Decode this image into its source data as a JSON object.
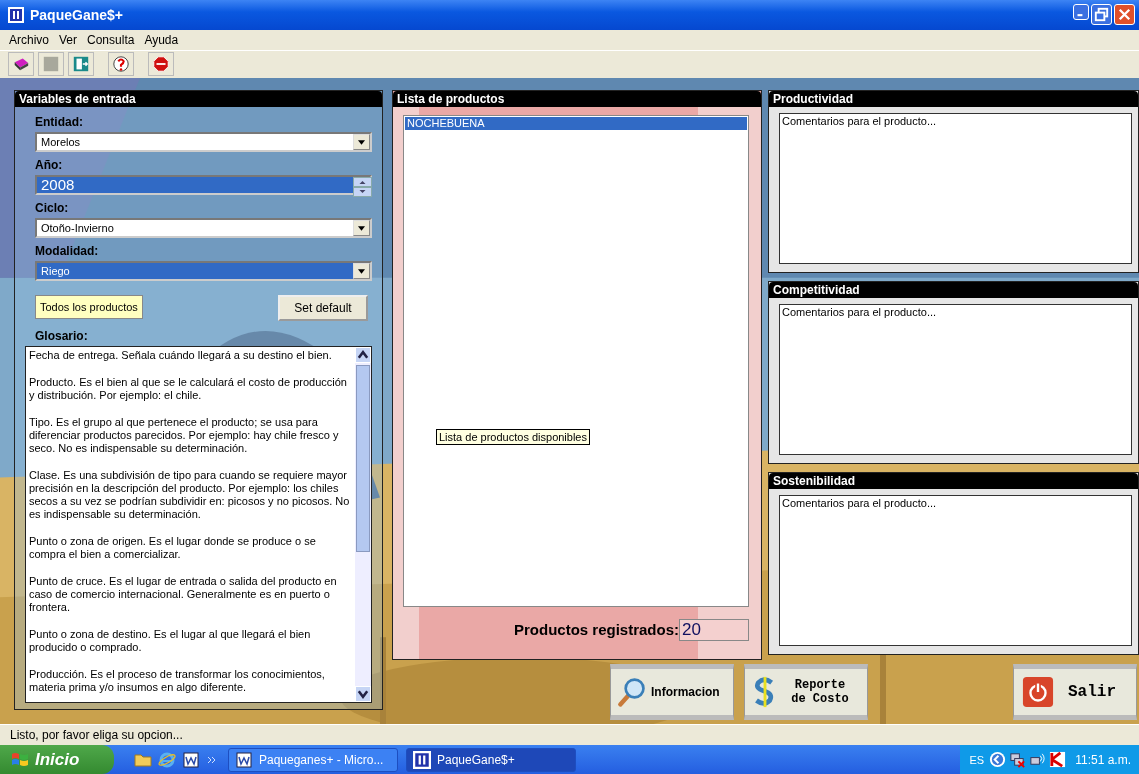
{
  "window": {
    "title": "PaqueGane$+"
  },
  "menu": [
    "Archivo",
    "Ver",
    "Consulta",
    "Ayuda"
  ],
  "inputs": {
    "title": "Variables de entrada",
    "fields": [
      {
        "label": "Entidad:",
        "kind": "combo",
        "value": "Morelos",
        "highlighted": false
      },
      {
        "label": "Año:",
        "kind": "spinner",
        "value": "2008",
        "highlighted": true
      },
      {
        "label": "Ciclo:",
        "kind": "combo",
        "value": "Otoño-Invierno",
        "highlighted": false
      },
      {
        "label": "Modalidad:",
        "kind": "combo",
        "value": "Riego",
        "highlighted": true
      }
    ],
    "all_products_button": "Todos los productos",
    "default_button": "Set default",
    "glossary_label": "Glosario:",
    "glossary": [
      "Fecha de entrega. Señala cuándo llegará a su destino el bien.",
      "Producto. Es el bien al que se le calculará el costo de producción y distribución. Por ejemplo: el chile.",
      "Tipo. Es el grupo al que pertenece el producto; se usa para diferenciar productos parecidos. Por ejemplo: hay chile fresco y seco. No es indispensable su determinación.",
      "Clase. Es una subdivisión de tipo para cuando se requiere mayor precisión en la descripción del producto. Por ejemplo: los chiles secos a su vez se podrían subdividir en: picosos y no picosos. No es indispensable su determinación.",
      "Punto o zona de origen. Es el lugar donde se produce o se compra el bien a comercializar.",
      "Punto de cruce. Es el lugar de entrada o salida del producto en caso de comercio internacional. Generalmente es en puerto o frontera.",
      "Punto o zona de destino. Es el lugar al que llegará el bien producido o comprado.",
      "Producción. Es el proceso de transformar los conocimientos, materia prima y/o insumos en algo diferente."
    ]
  },
  "products": {
    "title": "Lista de productos",
    "items": [
      {
        "label": "NOCHEBUENA",
        "selected": true
      }
    ],
    "tooltip": "Lista de productos disponibles",
    "count_label": "Productos registrados:",
    "count": "20"
  },
  "comments": [
    {
      "title": "Productividad",
      "text": "Comentarios para el producto..."
    },
    {
      "title": "Competitividad",
      "text": "Comentarios para el producto..."
    },
    {
      "title": "Sostenibilidad",
      "text": "Comentarios para el producto..."
    }
  ],
  "actions": [
    {
      "kind": "info",
      "label": "Informacion"
    },
    {
      "kind": "report",
      "label": "Reporte de Costo"
    },
    {
      "kind": "exit",
      "label": "Salir"
    }
  ],
  "status_bar": "Listo, por favor eliga su opcion...",
  "taskbar": {
    "start": "Inicio",
    "tasks": [
      {
        "label": "Paqueganes+ - Micro...",
        "active": false
      },
      {
        "label": "PaqueGane$+",
        "active": true
      }
    ],
    "language": "ES",
    "clock": "11:51 a.m."
  }
}
